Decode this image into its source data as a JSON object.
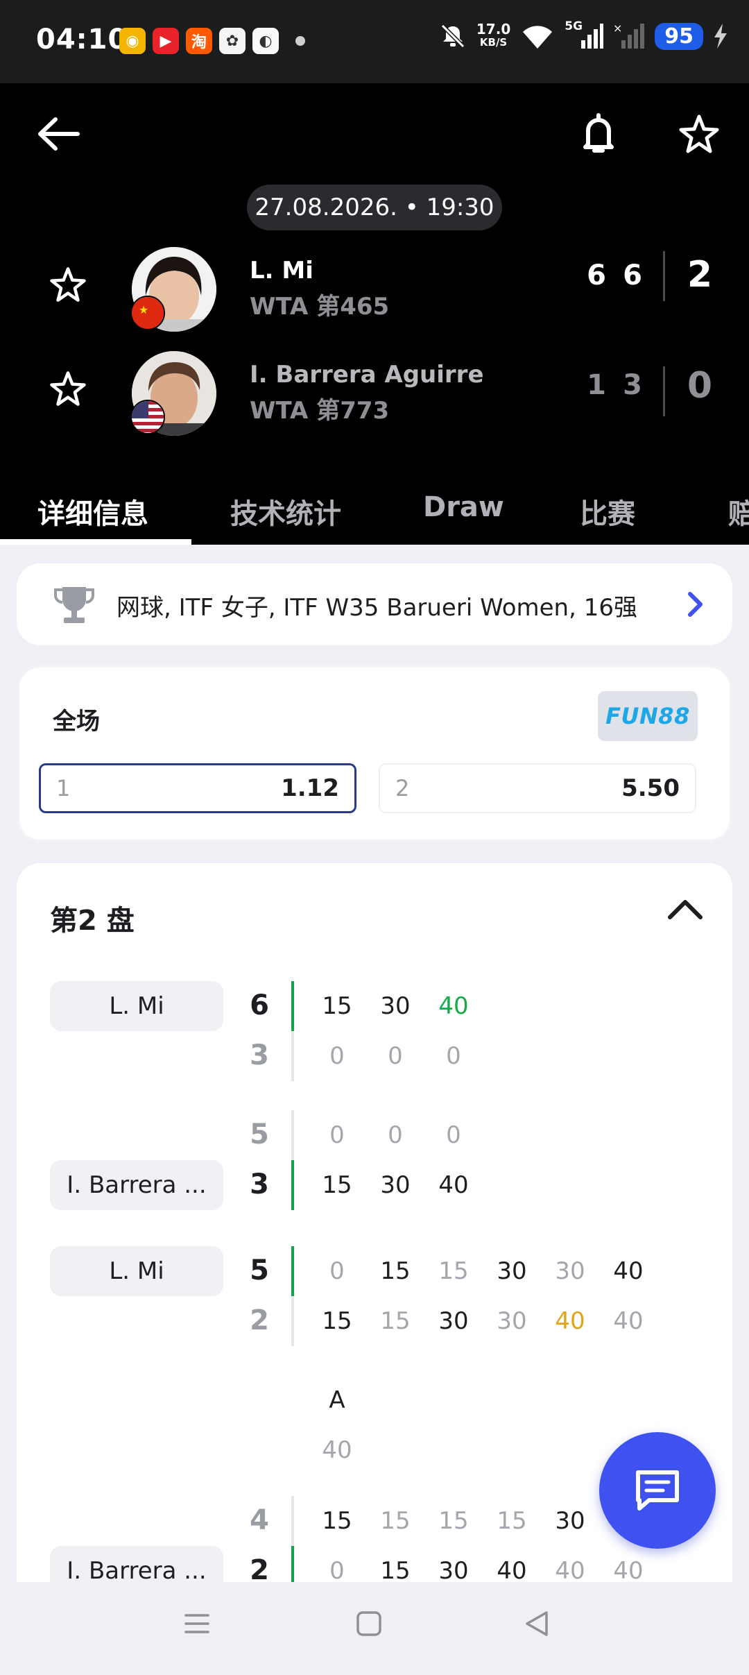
{
  "status_bar": {
    "time": "04:10",
    "apps": [
      {
        "icon": "weibo-icon",
        "glyph": "◉",
        "color": "#f4b400"
      },
      {
        "icon": "video-app-icon",
        "glyph": "▶",
        "color": "#e8242a"
      },
      {
        "icon": "taobao-icon",
        "glyph": "淘",
        "color": "#ff5a00"
      },
      {
        "icon": "photos-app-icon",
        "glyph": "✿",
        "color": "#f5f5f5"
      },
      {
        "icon": "qq-icon",
        "glyph": "◐",
        "color": "#fafafa"
      }
    ],
    "speed_value": "17.0",
    "speed_unit": "KB/S",
    "network": "5G",
    "battery": "95"
  },
  "header": {
    "back_icon": "back-arrow-icon",
    "bell_icon": "bell-icon",
    "star_icon": "star-icon",
    "datetime": "27.08.2026. • 19:30",
    "players": [
      {
        "name": "L. Mi",
        "rank": "WTA 第465",
        "flag": "china",
        "sets": [
          "6",
          "6"
        ],
        "total": "2",
        "winner": true
      },
      {
        "name": "I. Barrera Aguirre",
        "rank": "WTA 第773",
        "flag": "usa",
        "sets": [
          "1",
          "3"
        ],
        "total": "0",
        "winner": false
      }
    ],
    "tabs": [
      "详细信息",
      "技术统计",
      "Draw",
      "比赛",
      "赔"
    ],
    "active_tab": 0
  },
  "tournament": {
    "text": "网球, ITF 女子, ITF W35 Barueri Women, 16强"
  },
  "odds": {
    "title": "全场",
    "bookmaker": "FUN88",
    "options": [
      {
        "label": "1",
        "value": "1.12",
        "selected": true
      },
      {
        "label": "2",
        "value": "5.50",
        "selected": false
      }
    ]
  },
  "set_section": {
    "title": "第2 盘",
    "games": [
      {
        "server": "L. Mi",
        "server_row": 0,
        "rows": [
          {
            "score": "6",
            "win": true,
            "points": [
              [
                "15",
                "dark"
              ],
              [
                "30",
                "dark"
              ],
              [
                "40",
                "green"
              ]
            ]
          },
          {
            "score": "3",
            "win": false,
            "points": [
              [
                "0",
                "grey"
              ],
              [
                "0",
                "grey"
              ],
              [
                "0",
                "grey"
              ]
            ]
          }
        ]
      },
      {
        "server": "I. Barrera ...",
        "server_row": 1,
        "rows": [
          {
            "score": "5",
            "win": false,
            "points": [
              [
                "0",
                "grey"
              ],
              [
                "0",
                "grey"
              ],
              [
                "0",
                "grey"
              ]
            ]
          },
          {
            "score": "3",
            "win": true,
            "points": [
              [
                "15",
                "dark"
              ],
              [
                "30",
                "dark"
              ],
              [
                "40",
                "dark"
              ]
            ]
          }
        ]
      },
      {
        "server": "L. Mi",
        "server_row": 0,
        "rows": [
          {
            "score": "5",
            "win": true,
            "points": [
              [
                "0",
                "grey"
              ],
              [
                "15",
                "dark"
              ],
              [
                "15",
                "grey"
              ],
              [
                "30",
                "dark"
              ],
              [
                "30",
                "grey"
              ],
              [
                "40",
                "dark"
              ]
            ]
          },
          {
            "score": "2",
            "win": false,
            "points": [
              [
                "15",
                "dark"
              ],
              [
                "15",
                "grey"
              ],
              [
                "30",
                "dark"
              ],
              [
                "30",
                "grey"
              ],
              [
                "40",
                "gold"
              ],
              [
                "40",
                "grey"
              ]
            ]
          }
        ]
      },
      {
        "server": "",
        "server_row": -1,
        "rows": [
          {
            "score": "",
            "win": false,
            "points": [
              [
                "A",
                "dark"
              ]
            ]
          },
          {
            "score": "",
            "win": false,
            "points": [
              [
                "40",
                "grey"
              ]
            ]
          }
        ]
      },
      {
        "server": "I. Barrera ...",
        "server_row": 1,
        "rows": [
          {
            "score": "4",
            "win": false,
            "points": [
              [
                "15",
                "dark"
              ],
              [
                "15",
                "grey"
              ],
              [
                "15",
                "grey"
              ],
              [
                "15",
                "grey"
              ],
              [
                "30",
                "dark"
              ]
            ]
          },
          {
            "score": "2",
            "win": true,
            "points": [
              [
                "0",
                "grey"
              ],
              [
                "15",
                "dark"
              ],
              [
                "30",
                "dark"
              ],
              [
                "40",
                "dark"
              ],
              [
                "40",
                "grey"
              ],
              [
                "40",
                "grey"
              ]
            ]
          }
        ]
      }
    ]
  },
  "fab": {
    "icon": "chat-icon"
  },
  "nav": {
    "items": [
      "menu-icon",
      "home-icon",
      "back-icon"
    ]
  }
}
